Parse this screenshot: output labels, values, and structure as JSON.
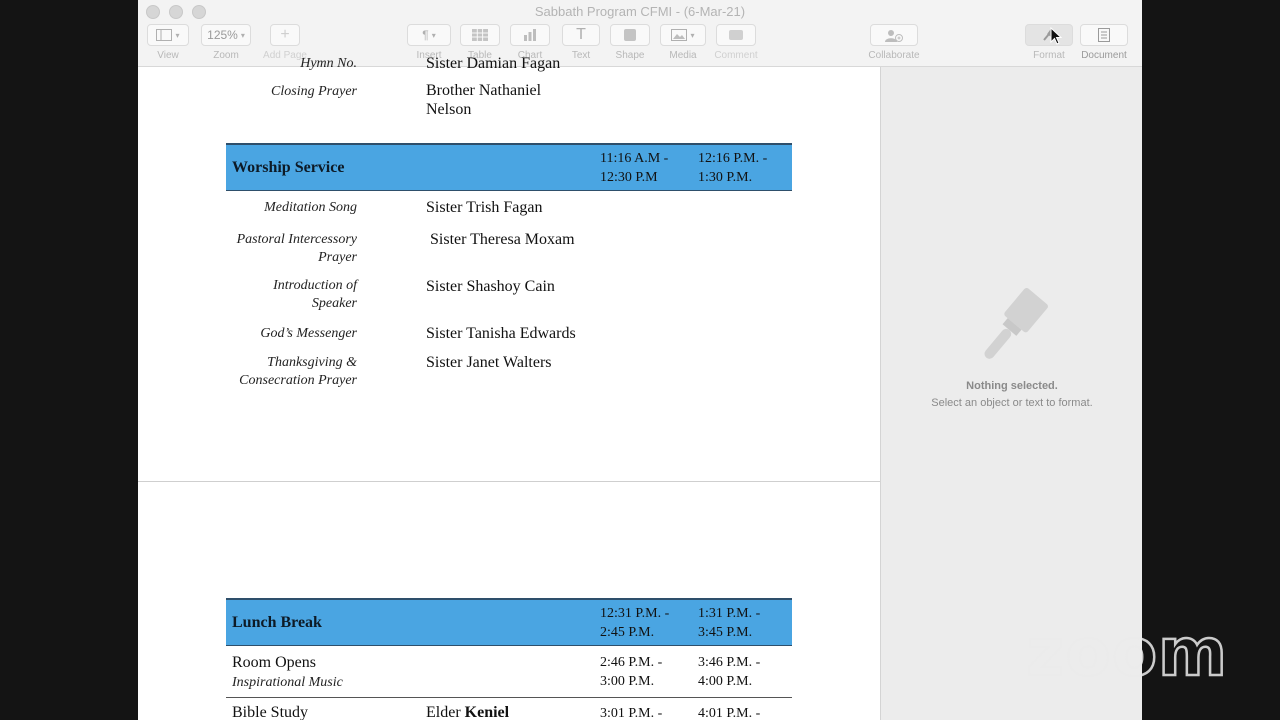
{
  "window": {
    "title": "Sabbath Program CFMI - (6-Mar-21)"
  },
  "toolbar": {
    "view": "View",
    "zoom_label": "Zoom",
    "zoom_value": "125%",
    "add_page": "Add Page",
    "insert": "Insert",
    "table": "Table",
    "chart": "Chart",
    "text": "Text",
    "shape": "Shape",
    "media": "Media",
    "comment": "Comment",
    "collaborate": "Collaborate",
    "format": "Format",
    "document": "Document"
  },
  "doc": {
    "cut_top_role": "Hymn No.",
    "cut_top_person": "Sister Damian Fagan",
    "closing_prayer": {
      "role": "Closing Prayer",
      "person_line1": "Brother Nathaniel",
      "person_line2": "Nelson"
    },
    "worship": {
      "title": "Worship Service",
      "time1": "11:16 A.M -\n12:30 P.M",
      "time2": "12:16 P.M. -\n1:30 P.M."
    },
    "worship_items": [
      {
        "role": "Meditation Song",
        "person": "Sister Trish Fagan"
      },
      {
        "role_line1": "Pastoral Intercessory",
        "role_line2": "Prayer",
        "person": "Sister Theresa Moxam"
      },
      {
        "role_line1": "Introduction of",
        "role_line2": "Speaker",
        "person": "Sister Shashoy Cain"
      },
      {
        "role": "God’s Messenger",
        "person": "Sister Tanisha Edwards"
      },
      {
        "role_line1": "Thanksgiving &",
        "role_line2": "Consecration Prayer",
        "person": "Sister Janet Walters"
      }
    ],
    "lunch": {
      "title": "Lunch Break",
      "time1": "12:31 P.M. -\n2:45 P.M.",
      "time2": "1:31 P.M. -\n3:45 P.M."
    },
    "room_opens": {
      "title": "Room Opens",
      "subtitle": "Inspirational Music",
      "time1": "2:46 P.M. -\n3:00 P.M.",
      "time2": "3:46 P.M. -\n4:00 P.M."
    },
    "bible_study": {
      "title": "Bible Study",
      "person_prefix": "Elder ",
      "person_bold": "Keniel",
      "time1": "3:01 P.M. -",
      "time2": "4:01 P.M. -"
    }
  },
  "inspector": {
    "title": "Nothing selected.",
    "subtitle": "Select an object or text to format."
  },
  "overlay": {
    "zoom_logo": "zoom"
  }
}
